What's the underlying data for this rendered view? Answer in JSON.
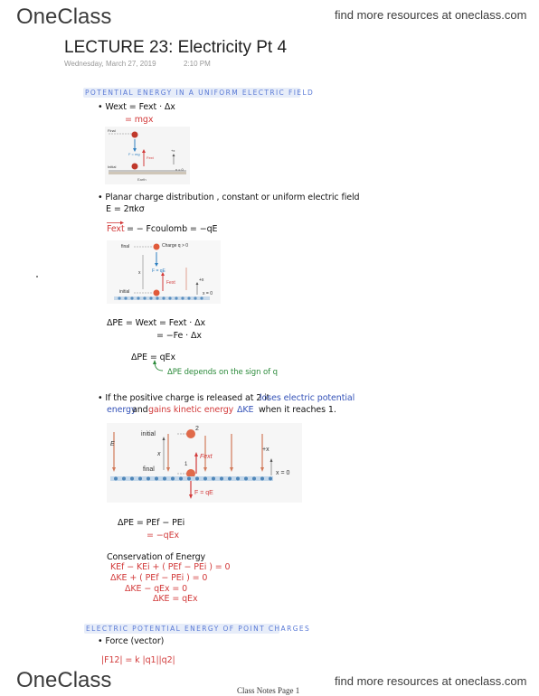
{
  "header": {
    "logo": "OneClass",
    "tagline": "find more resources at oneclass.com"
  },
  "footer": {
    "logo": "OneClass",
    "tagline": "find more resources at oneclass.com",
    "page_label": "Class Notes Page 1"
  },
  "note": {
    "title": "LECTURE 23: Electricity Pt 4",
    "date": "Wednesday, March 27, 2019",
    "time": "2:10 PM"
  },
  "section1": {
    "heading": "POTENTIAL ENERGY IN A UNIFORM ELECTRIC FIELD",
    "line1": "• Wext = Fext · Δx",
    "line2": "= mgx"
  },
  "figure1": {
    "final": "Final",
    "initial": "Initial",
    "force": "F = mg",
    "fext": "Fext",
    "axis": "x = 0",
    "plus_x": "+x",
    "earth": "Earth"
  },
  "section1b": {
    "line1": "• Planar charge distribution , constant or uniform electric field",
    "line2": "E = 2πkσ",
    "fext": "Fext",
    "eq": "= − Fcoulomb = −qE"
  },
  "figure2": {
    "charge": "Charge q > 0",
    "final": "final",
    "initial": "initial",
    "force": "F = qE",
    "fext": "Fext",
    "plus_x": "+x",
    "axis": "x = 0",
    "x": "x"
  },
  "calc1": {
    "line1": "ΔPE = Wext = Fext · Δx",
    "line2": "= −Fe · Δx",
    "line3": "ΔPE = qEx",
    "note": "ΔPE depends on the sign of q"
  },
  "section1c": {
    "p1_a": "• If the positive charge is released at 2 it",
    "p1_b": "loses electric potential",
    "p2_a": "energy",
    "p2_b": "and",
    "p2_c": "gains kinetic energy",
    "p2_d": "ΔKE",
    "p2_e": "when it reaches 1."
  },
  "figure3": {
    "e": "E",
    "initial": "initial",
    "final": "final",
    "label2": "2",
    "label1": "1",
    "x": "x",
    "fext": "Fext",
    "plus_x": "+x",
    "axis": "x = 0",
    "force": "F = qE"
  },
  "calc2": {
    "line1": "ΔPE = PEf − PEi",
    "line2": "= −qEx",
    "cons_title": "Conservation of Energy",
    "cons1": "KEf − KEi + ( PEf − PEi ) = 0",
    "cons2": "ΔKE + ( PEf − PEi ) = 0",
    "cons3": "ΔKE − qEx = 0",
    "cons4": "ΔKE = qEx"
  },
  "section2": {
    "heading": "ELECTRIC POTENTIAL ENERGY OF POINT CHARGES",
    "line1": "• Force (vector)",
    "line2": "|F12| = k |q1||q2|"
  }
}
